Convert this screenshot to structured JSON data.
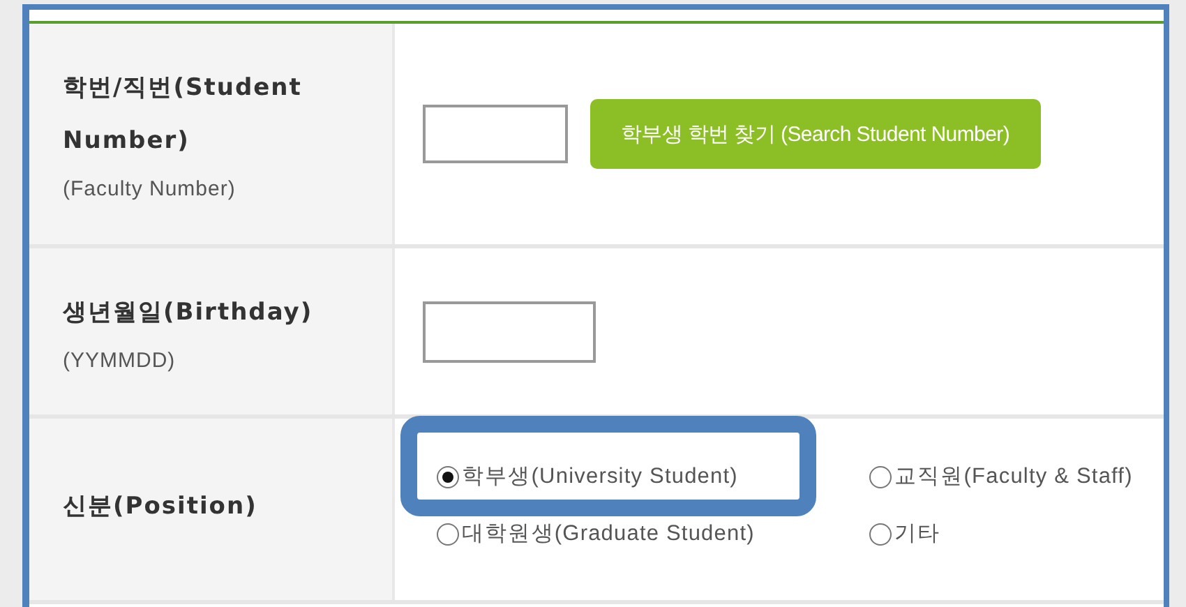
{
  "form": {
    "rows": [
      {
        "kind": "id",
        "label": "학번/직번(Student Number)",
        "sublabel": "(Faculty Number)",
        "button": "학부생 학번 찾기 (Search Student Number)"
      },
      {
        "kind": "birthday",
        "label": "생년월일(Birthday)",
        "sublabel": "(YYMMDD)"
      },
      {
        "kind": "position",
        "label": "신분(Position)",
        "options": [
          {
            "label": "학부생(University Student)",
            "selected": true,
            "highlighted": true
          },
          {
            "label": "교직원(Faculty & Staff)",
            "selected": false,
            "highlighted": false
          },
          {
            "label": "대학원생(Graduate Student)",
            "selected": false,
            "highlighted": false
          },
          {
            "label": "기타",
            "selected": false,
            "highlighted": false
          }
        ]
      }
    ]
  }
}
